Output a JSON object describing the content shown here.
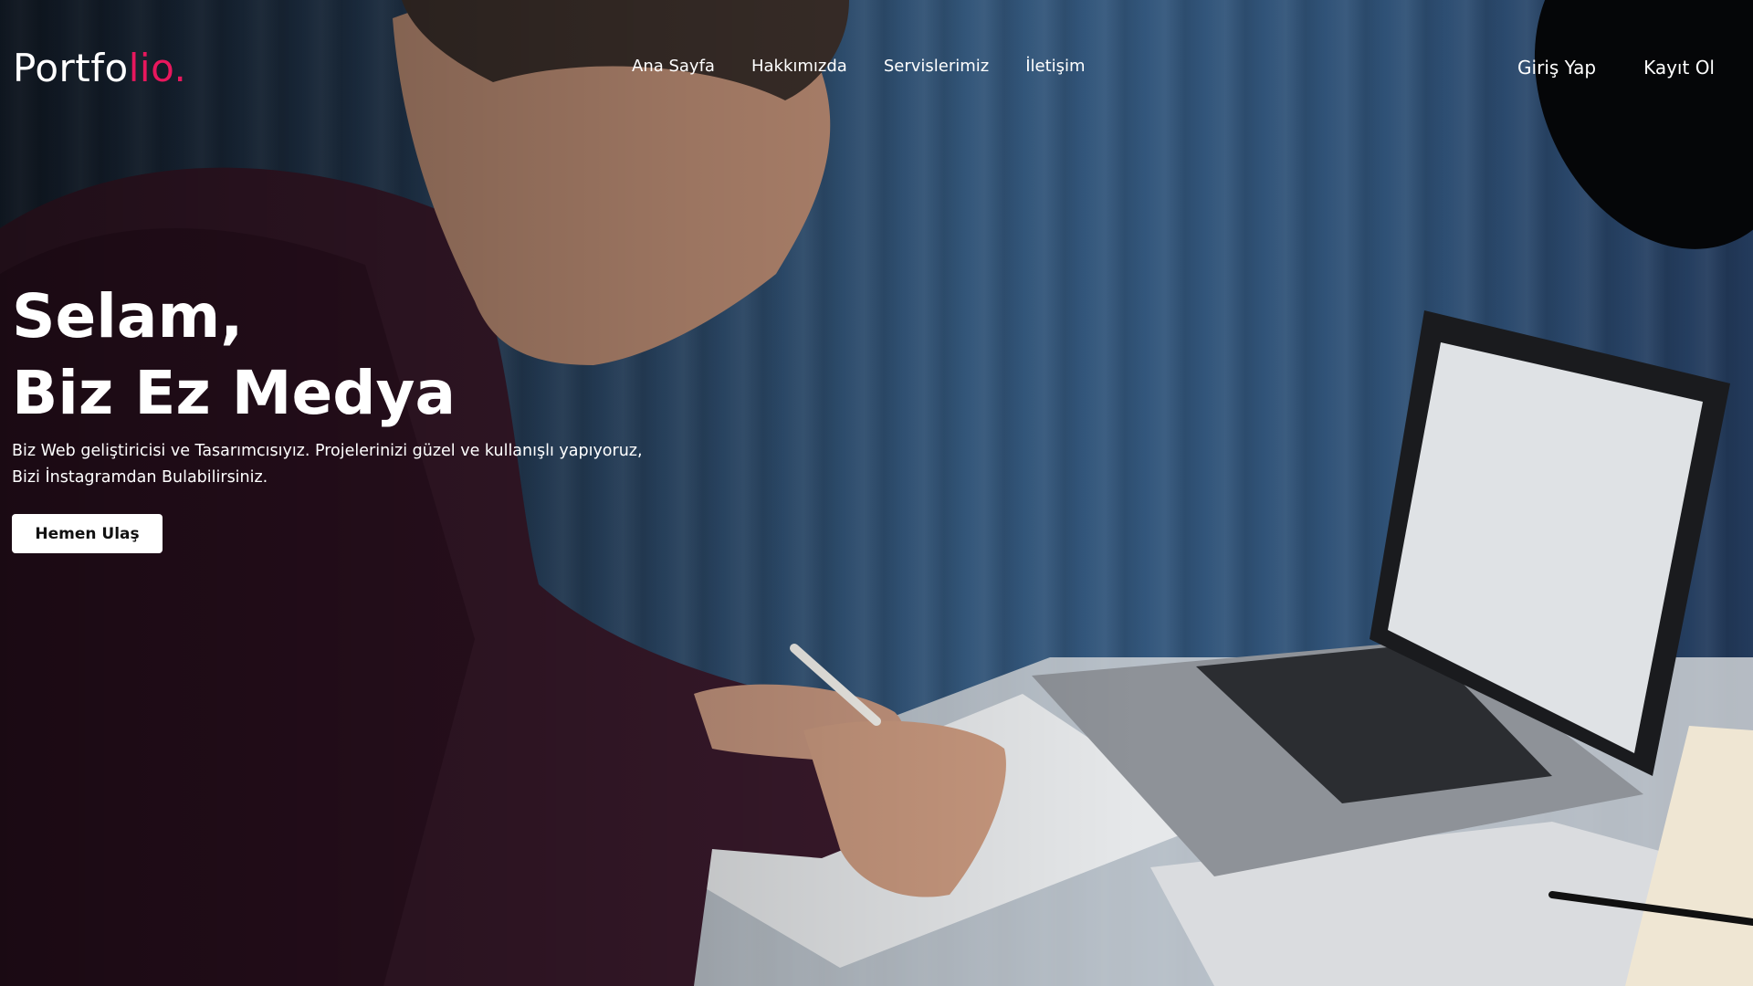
{
  "header": {
    "logo": {
      "text_main": "Portfo",
      "text_accent": "lio.",
      "accent_color": "#e8175d"
    },
    "nav": [
      "Ana Sayfa",
      "Hakkımızda",
      "Servislerimiz",
      "İletişim"
    ],
    "auth": {
      "login": "Giriş Yap",
      "register": "Kayıt Ol"
    }
  },
  "hero": {
    "title_line1": "Selam,",
    "title_line2": "Biz Ez Medya",
    "description_line1": "Biz Web geliştiricisi ve Tasarımcısıyız. Projelerinizi güzel ve kullanışlı yapıyoruz,",
    "description_line2": "Bizi İnstagramdan Bulabilirsiniz.",
    "cta_label": "Hemen Ulaş"
  }
}
